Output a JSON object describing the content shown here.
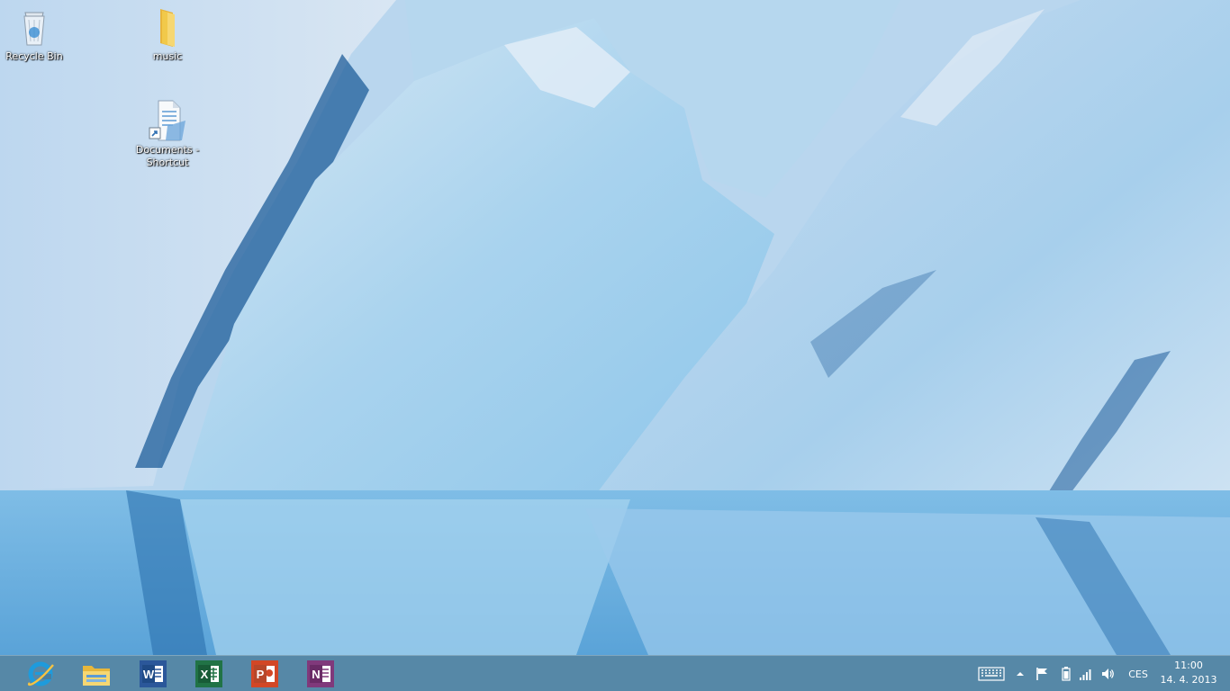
{
  "desktop": {
    "icons": [
      {
        "label": "Recycle Bin",
        "icon": "recycle-bin-icon"
      },
      {
        "label": "music",
        "icon": "folder-icon"
      },
      {
        "label": "Documents - Shortcut",
        "icon": "document-shortcut-icon"
      }
    ],
    "wallpaper": "glacier-ice-reflection"
  },
  "taskbar": {
    "pinned_apps": [
      {
        "name": "Internet Explorer",
        "icon": "internet-explorer-icon",
        "color": "#1e9bdc"
      },
      {
        "name": "File Explorer",
        "icon": "file-explorer-icon",
        "color": "#f1c94a"
      },
      {
        "name": "Word",
        "icon": "word-icon",
        "color": "#2b579a"
      },
      {
        "name": "Excel",
        "icon": "excel-icon",
        "color": "#217346"
      },
      {
        "name": "PowerPoint",
        "icon": "powerpoint-icon",
        "color": "#d24726"
      },
      {
        "name": "OneNote",
        "icon": "onenote-icon",
        "color": "#80397b"
      }
    ],
    "tray": {
      "icons": [
        "keyboard-icon",
        "chevron-up-icon",
        "action-center-flag-icon",
        "battery-icon",
        "signal-icon",
        "volume-icon"
      ],
      "language": "CES",
      "time": "11:00",
      "date": "14. 4. 2013"
    }
  },
  "colors": {
    "taskbar": "#487ea0",
    "accent_blue": "#1e9bdc"
  }
}
